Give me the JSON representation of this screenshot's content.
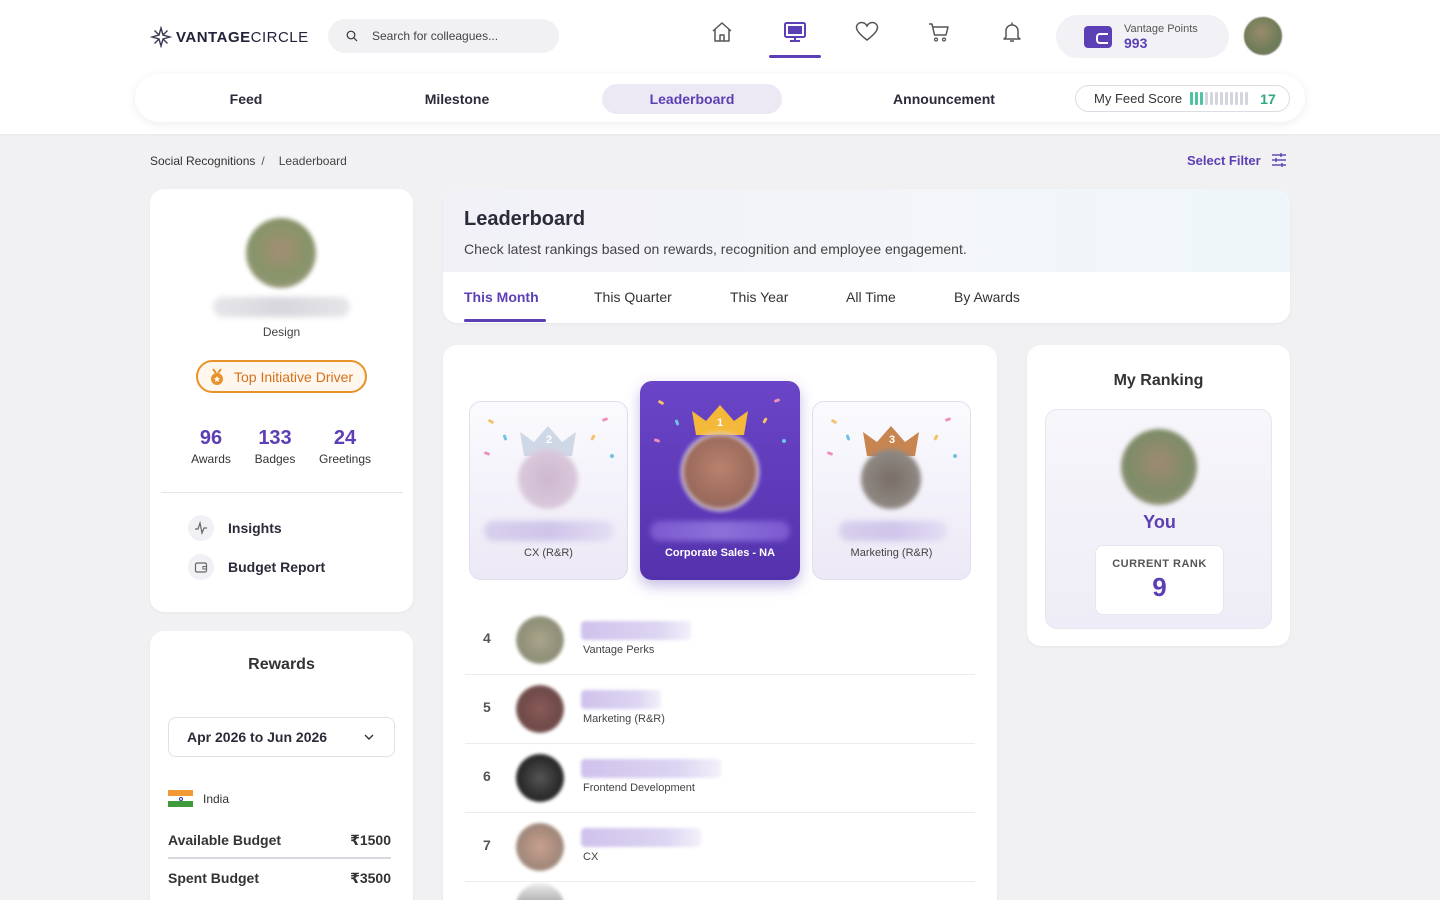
{
  "brand": {
    "logo_bold": "VANTAGE",
    "logo_light": "CIRCLE"
  },
  "search": {
    "placeholder": "Search for colleagues..."
  },
  "nav_icons": [
    "home-icon",
    "desktop-icon",
    "heart-icon",
    "cart-icon",
    "bell-icon"
  ],
  "points": {
    "label": "Vantage Points",
    "value": "993"
  },
  "tabs": [
    {
      "label": "Feed"
    },
    {
      "label": "Milestone"
    },
    {
      "label": "Leaderboard",
      "active": true
    },
    {
      "label": "Announcement"
    }
  ],
  "feed_score": {
    "label": "My Feed Score",
    "value": "17",
    "level": 0.25
  },
  "breadcrumb": {
    "parent": "Social Recognitions",
    "separator": "/",
    "current": "Leaderboard"
  },
  "filter": {
    "label": "Select Filter"
  },
  "profile": {
    "department": "Design",
    "badge": "Top Initiative Driver",
    "stats": [
      {
        "value": "96",
        "label": "Awards"
      },
      {
        "value": "133",
        "label": "Badges"
      },
      {
        "value": "24",
        "label": "Greetings"
      }
    ],
    "menu": [
      {
        "label": "Insights",
        "icon": "activity-icon"
      },
      {
        "label": "Budget Report",
        "icon": "wallet-icon"
      }
    ]
  },
  "rewards": {
    "title": "Rewards",
    "period": "Apr 2026 to Jun 2026",
    "country": "India",
    "rows": [
      {
        "label": "Available Budget",
        "value": "₹1500"
      },
      {
        "label": "Spent Budget",
        "value": "₹3500"
      }
    ]
  },
  "leaderboard": {
    "title": "Leaderboard",
    "subtitle": "Check latest rankings based on rewards, recognition and employee engagement.",
    "periods": [
      {
        "label": "This Month",
        "active": true
      },
      {
        "label": "This Quarter"
      },
      {
        "label": "This Year"
      },
      {
        "label": "All Time"
      },
      {
        "label": "By Awards"
      }
    ],
    "podium": [
      {
        "rank": "2",
        "department": "CX (R&R)"
      },
      {
        "rank": "1",
        "department": "Corporate Sales - NA"
      },
      {
        "rank": "3",
        "department": "Marketing (R&R)"
      }
    ],
    "rows": [
      {
        "rank": "4",
        "department": "Vantage Perks"
      },
      {
        "rank": "5",
        "department": "Marketing (R&R)"
      },
      {
        "rank": "6",
        "department": "Frontend Development"
      },
      {
        "rank": "7",
        "department": "CX"
      }
    ]
  },
  "my_ranking": {
    "title": "My Ranking",
    "you": "You",
    "rank_label": "CURRENT RANK",
    "rank": "9"
  },
  "colors": {
    "accent": "#5c3fb4",
    "badge": "#e8922b",
    "score": "#2bab7f"
  }
}
